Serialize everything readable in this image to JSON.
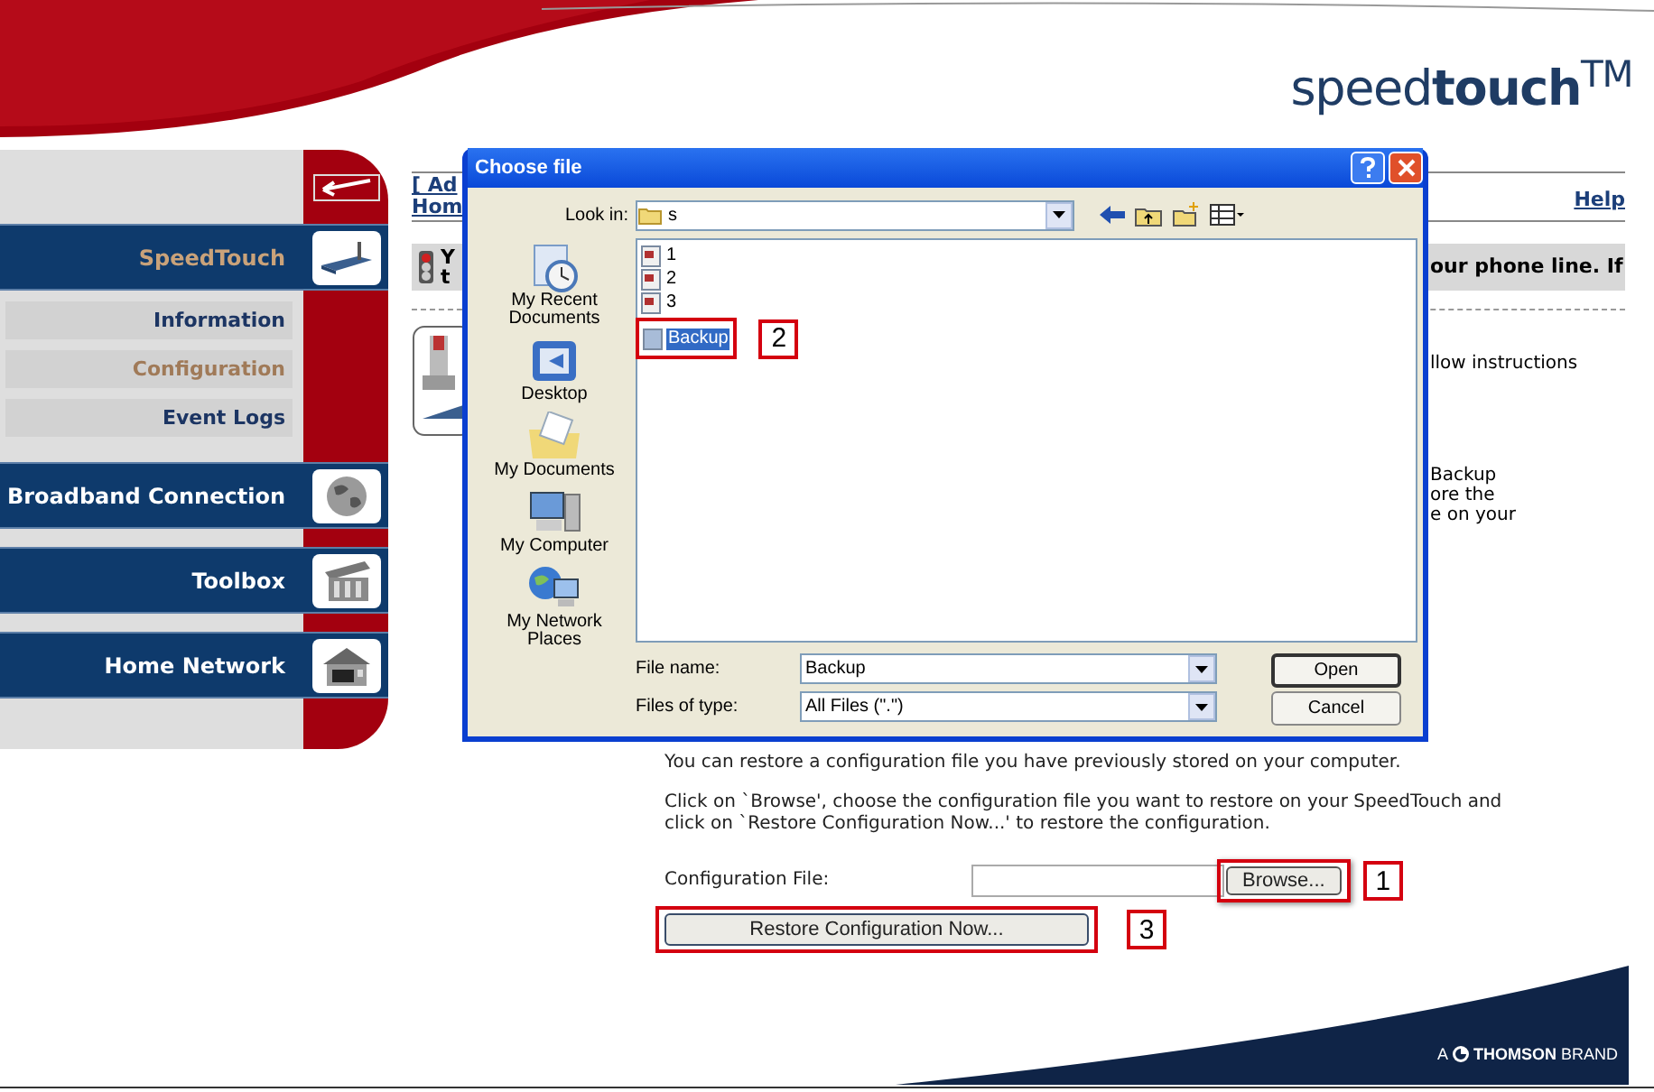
{
  "logo": "speed**touch**$^{TM}$",
  "sidebar": [
    {
      "kind": "section",
      "label": "SpeedTouch",
      "selected": true
    },
    {
      "kind": "subitem",
      "label": "Information",
      "selected": false
    },
    {
      "kind": "subitem",
      "label": "Configuration",
      "selected": true
    },
    {
      "kind": "subitem",
      "label": "Event Logs",
      "selected": false
    },
    {
      "kind": "section",
      "label": "Broadband Connection",
      "selected": false
    },
    {
      "kind": "section",
      "label": "Toolbox",
      "selected": false
    },
    {
      "kind": "section",
      "label": "Home Network",
      "selected": false
    }
  ],
  "top_links": {
    "left": [
      "[ Ad",
      "Hom"
    ],
    "right": "Help"
  },
  "banner": {
    "left": [
      "Y",
      "t"
    ],
    "right": "our phone line. If"
  },
  "hidden_text": {
    "line_1": "llow instructions",
    "lines_2": [
      "Backup",
      "ore the",
      "e on your"
    ]
  },
  "restore": {
    "intro": "You can restore a configuration file you have previously stored on your computer.",
    "instructions": "Click on `Browse', choose the configuration file you want to restore on your SpeedTouch and click on `Restore Configuration Now...' to restore the configuration.",
    "file_label": "Configuration File:",
    "browse_button": "Browse...",
    "browse_callout": "1",
    "restore_button": "Restore Configuration Now...",
    "restore_callout": "3"
  },
  "dialog": {
    "title": "Choose file",
    "look_in_label": "Look in:",
    "look_in": "s",
    "places": [
      {
        "label": "My Recent Documents"
      },
      {
        "label": "Desktop"
      },
      {
        "label": "My Documents"
      },
      {
        "label": "My Computer"
      },
      {
        "label": "My Network Places"
      }
    ],
    "files": [
      {
        "name": "1",
        "selected": false
      },
      {
        "name": "2",
        "selected": false
      },
      {
        "name": "3",
        "selected": false
      },
      {
        "name": "Backup",
        "selected": true
      }
    ],
    "file_callout": "2",
    "file_name_label": "File name:",
    "file_name": "Backup",
    "type_label": "Files of type:",
    "type": "All Files (\".\")",
    "buttons": [
      "Open",
      "Cancel"
    ]
  },
  "footer": {
    "prefix": "A",
    "brand": "**THOMSON** BRAND"
  }
}
